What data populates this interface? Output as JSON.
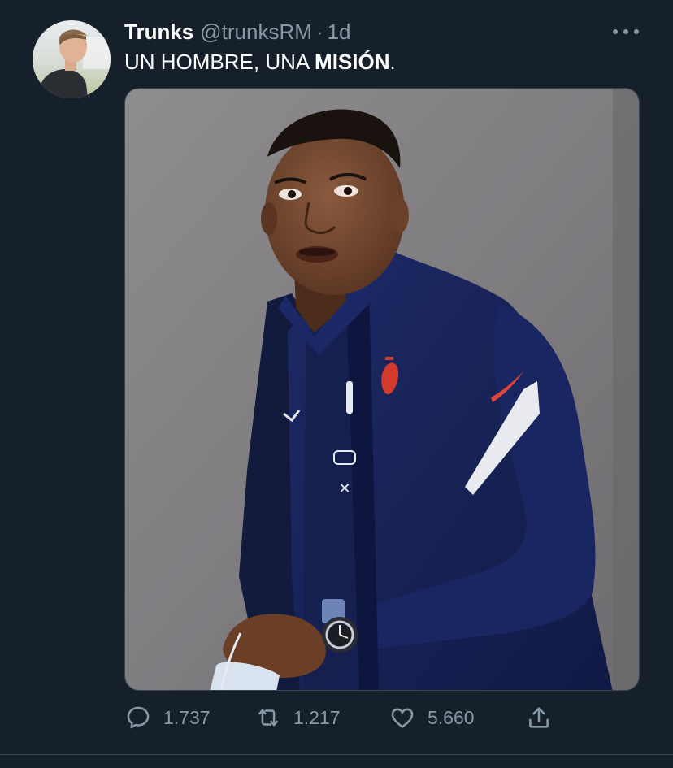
{
  "tweet": {
    "author_name": "Trunks",
    "author_handle": "@trunksRM",
    "separator": "·",
    "timestamp": "1d",
    "text_plain": "UN HOMBRE, UNA ",
    "text_bold": "MISIÓN",
    "text_end": ".",
    "avatar_icon": "user-avatar-photo",
    "media_icon": "attached-photo",
    "more_icon": "more-horizontal-icon"
  },
  "actions": {
    "reply": {
      "icon": "reply-icon",
      "count": "1.737"
    },
    "retweet": {
      "icon": "retweet-icon",
      "count": "1.217"
    },
    "like": {
      "icon": "like-icon",
      "count": "5.660"
    },
    "share": {
      "icon": "share-icon"
    }
  },
  "colors": {
    "background": "#15202b",
    "secondary_text": "#8899a6",
    "primary_text": "#ffffff",
    "border": "#38444d"
  }
}
